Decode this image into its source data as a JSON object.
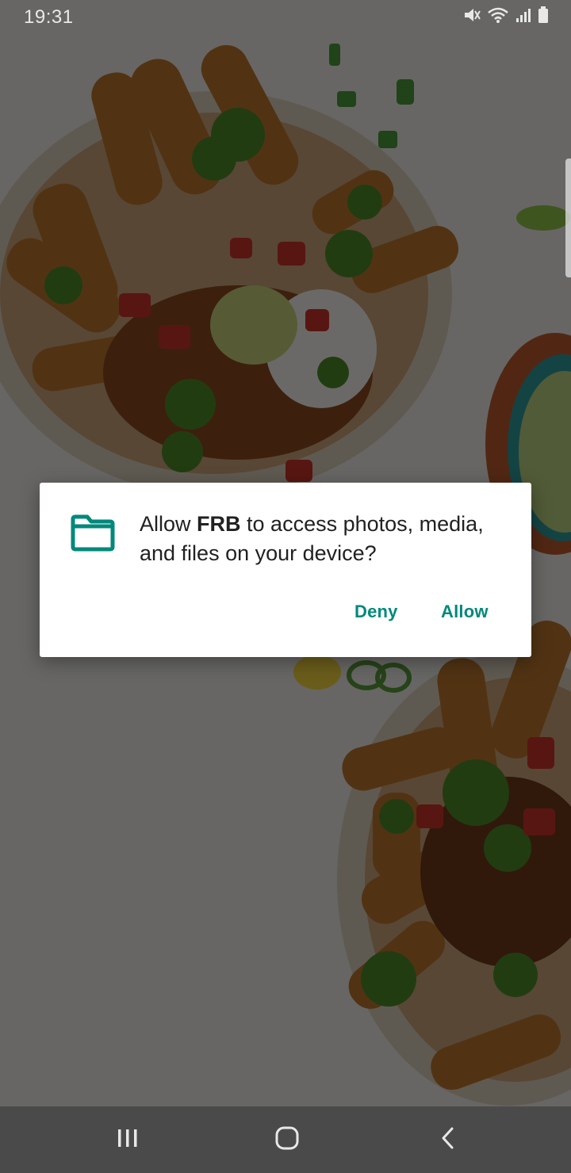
{
  "status_bar": {
    "time": "19:31",
    "icons": [
      "mute-icon",
      "wifi-icon",
      "signal-icon",
      "battery-icon"
    ]
  },
  "dialog": {
    "icon": "folder-icon",
    "message_prefix": "Allow ",
    "app_name": "FRB",
    "message_suffix": " to access photos, media, and files on your device?",
    "deny_label": "Deny",
    "allow_label": "Allow"
  },
  "colors": {
    "accent": "#00897b",
    "dialog_background": "#ffffff",
    "navbar": "#4a4a4a"
  },
  "nav_bar": {
    "buttons": [
      "recents-icon",
      "home-icon",
      "back-icon"
    ]
  }
}
